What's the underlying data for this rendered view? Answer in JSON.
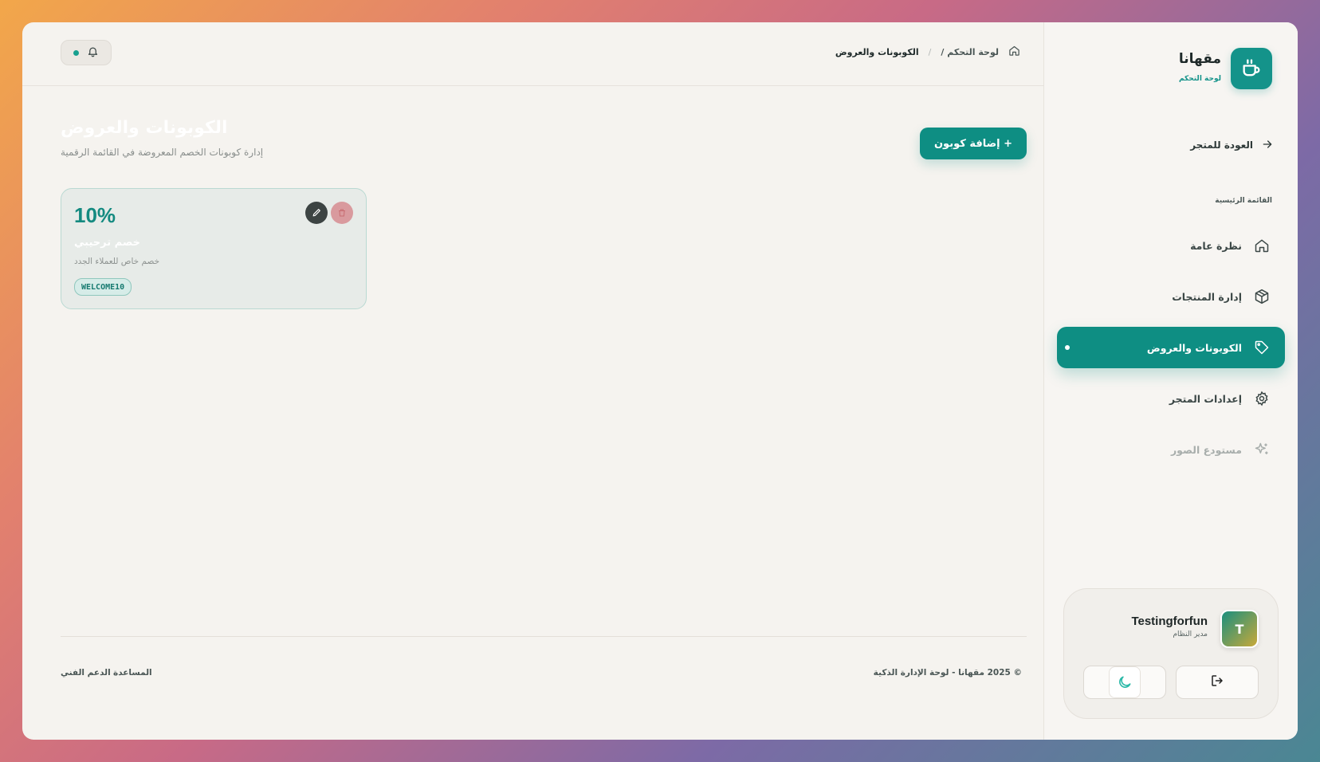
{
  "brand": {
    "name": "مقهانا",
    "subtitle": "لوحة التحكم",
    "icon": "coffee-cup-icon"
  },
  "sidebar": {
    "back_label": "العودة للمتجر",
    "section_label": "القائمة الرئيسية",
    "items": [
      {
        "label": "نظرة عامة",
        "icon": "home-icon"
      },
      {
        "label": "إدارة المنتجات",
        "icon": "box-icon"
      },
      {
        "label": "الكوبونات والعروض",
        "icon": "tag-icon",
        "active": true
      },
      {
        "label": "إعدادات المتجر",
        "icon": "gear-icon"
      },
      {
        "label": "مستودع الصور",
        "icon": "sparkle-icon",
        "muted": true
      }
    ]
  },
  "user": {
    "initial": "T",
    "name": "Testingforfun",
    "role": "مدير النظام"
  },
  "breadcrumb": {
    "home": "/ لوحة التحكم",
    "separator": "/",
    "current": "الكوبونات والعروض"
  },
  "page": {
    "title": "الكوبونات والعروض",
    "subtitle": "إدارة كوبونات الخصم المعروضة في القائمة الرقمية",
    "add_button": "إضافة كوبون +"
  },
  "coupons": [
    {
      "discount": "10%",
      "title": "خصم ترحيبي",
      "description": "خصم خاص للعملاء الجدد",
      "code": "WELCOME10"
    }
  ],
  "footer": {
    "copyright": "© 2025 مقهانا - لوحة الإدارة الذكية",
    "help": "المساعدة",
    "support": "الدعم الفني"
  },
  "colors": {
    "accent": "#0e8e83",
    "background": "#f5f3ef"
  }
}
